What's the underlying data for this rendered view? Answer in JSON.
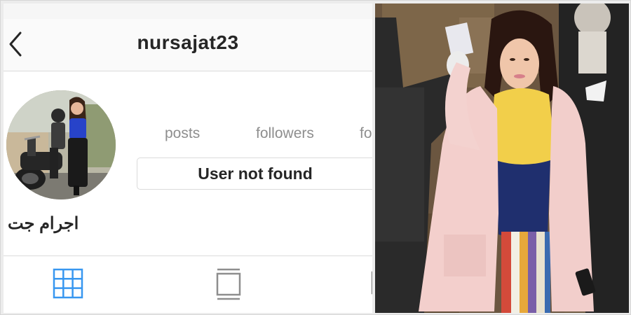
{
  "profile": {
    "username": "nursajat23",
    "display_name": "اجرام جت",
    "stats": {
      "posts_label": "posts",
      "followers_label": "followers",
      "following_label_partial": "fo"
    },
    "status_message": "User not found"
  },
  "icons": {
    "back": "chevron-left-icon",
    "grid": "grid-icon",
    "list": "feed-list-icon"
  },
  "colors": {
    "accent_blue": "#3897f0",
    "text_dark": "#262626",
    "text_muted": "#8e8e8e",
    "border": "#dbdbdb"
  }
}
